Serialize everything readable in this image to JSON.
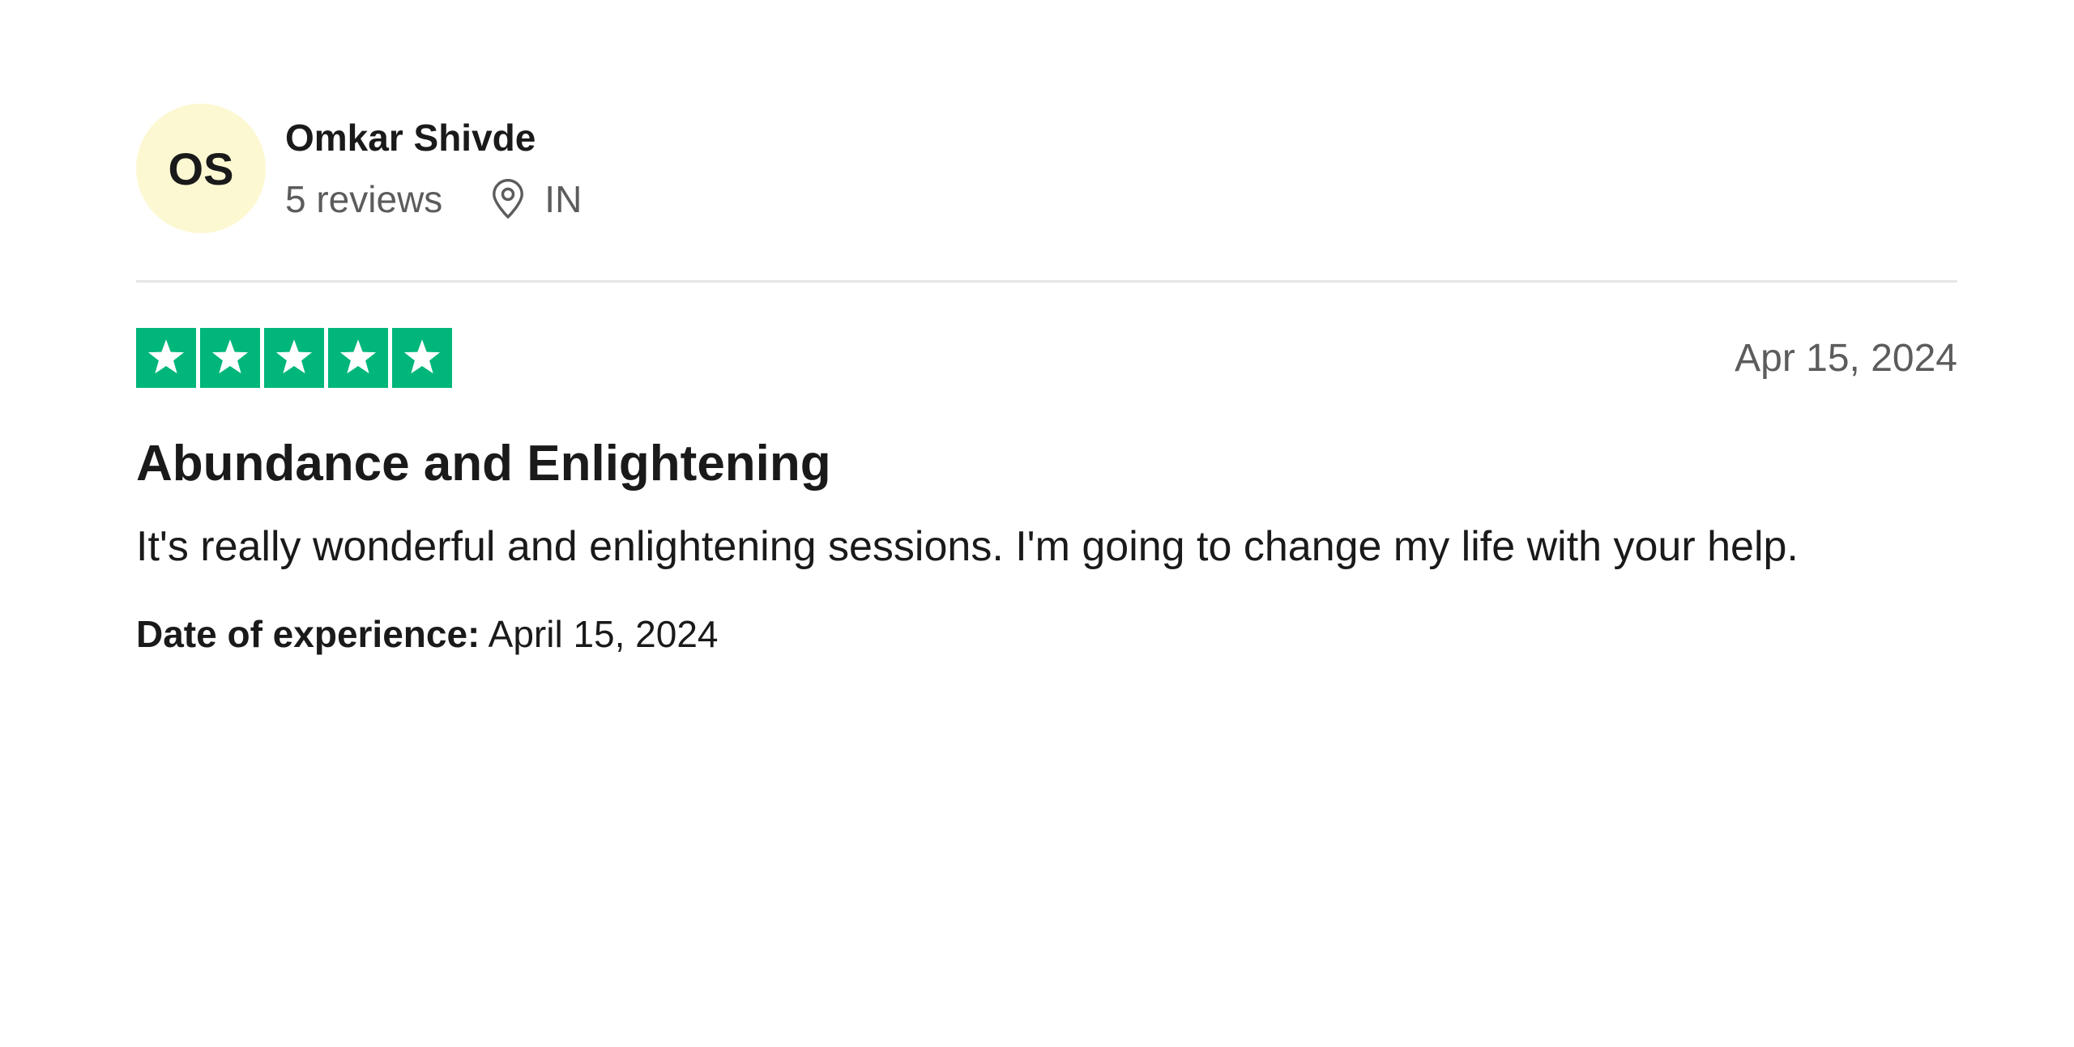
{
  "consumer": {
    "initials": "OS",
    "name": "Omkar Shivde",
    "reviews": "5 reviews",
    "location": "IN",
    "avatar_bg": "#fcf8d2"
  },
  "review": {
    "rating": 5,
    "rating_max": 5,
    "star_color": "#00b67a",
    "date": "Apr 15, 2024",
    "title": "Abundance and Enlightening",
    "text": "It's really wonderful and enlightening sessions. I'm going to change my life with your help.",
    "experience_label": "Date of experience:",
    "experience_date": "April 15, 2024"
  },
  "icons": {
    "location": "location-pin-icon",
    "star": "star-icon"
  }
}
